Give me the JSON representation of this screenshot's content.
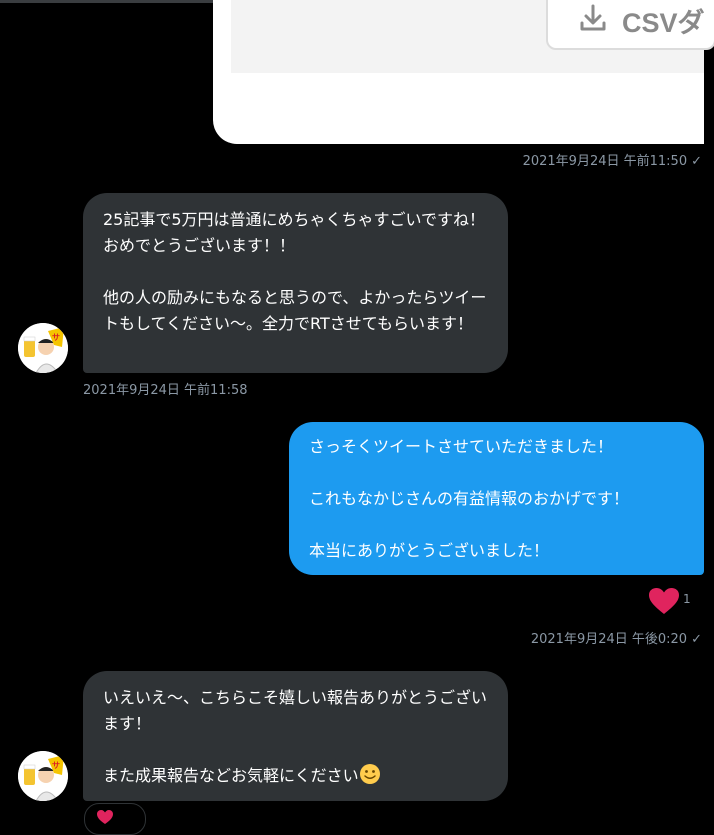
{
  "attachment_card": {
    "button_label": "CSVダ",
    "icon": "download-icon"
  },
  "messages": [
    {
      "direction": "out",
      "timestamp": "2021年9月24日 午前11:50",
      "status_icon": "check-icon"
    },
    {
      "direction": "in",
      "paragraphs": [
        "25記事で5万円は普通にめちゃくちゃすごいですね！おめでとうございます！！",
        "他の人の励みにもなると思うので、よかったらツイートもしてください〜。全力でRTさせてもらいます！"
      ],
      "timestamp": "2021年9月24日 午前11:58",
      "avatar_icon": "avatar-icon"
    },
    {
      "direction": "out",
      "paragraphs": [
        "さっそくツイートさせていただきました！",
        "これもなかじさんの有益情報のおかげです！",
        "本当にありがとうございました！"
      ],
      "reaction": {
        "icon": "heart-icon",
        "count": "1"
      },
      "timestamp": "2021年9月24日 午後0:20",
      "status_icon": "check-icon"
    },
    {
      "direction": "in",
      "paragraphs": [
        "いえいえ〜、こちらこそ嬉しい報告ありがとうございます！",
        "また成果報告などお気軽にください"
      ],
      "trailing_emoji": "slightly-smiling-face-icon",
      "avatar_icon": "avatar-icon"
    }
  ],
  "colors": {
    "background": "#000000",
    "incoming_bubble": "#2f3336",
    "outgoing_bubble": "#1d9bf0",
    "timestamp": "#8b98a5",
    "heart": "#f91880"
  }
}
